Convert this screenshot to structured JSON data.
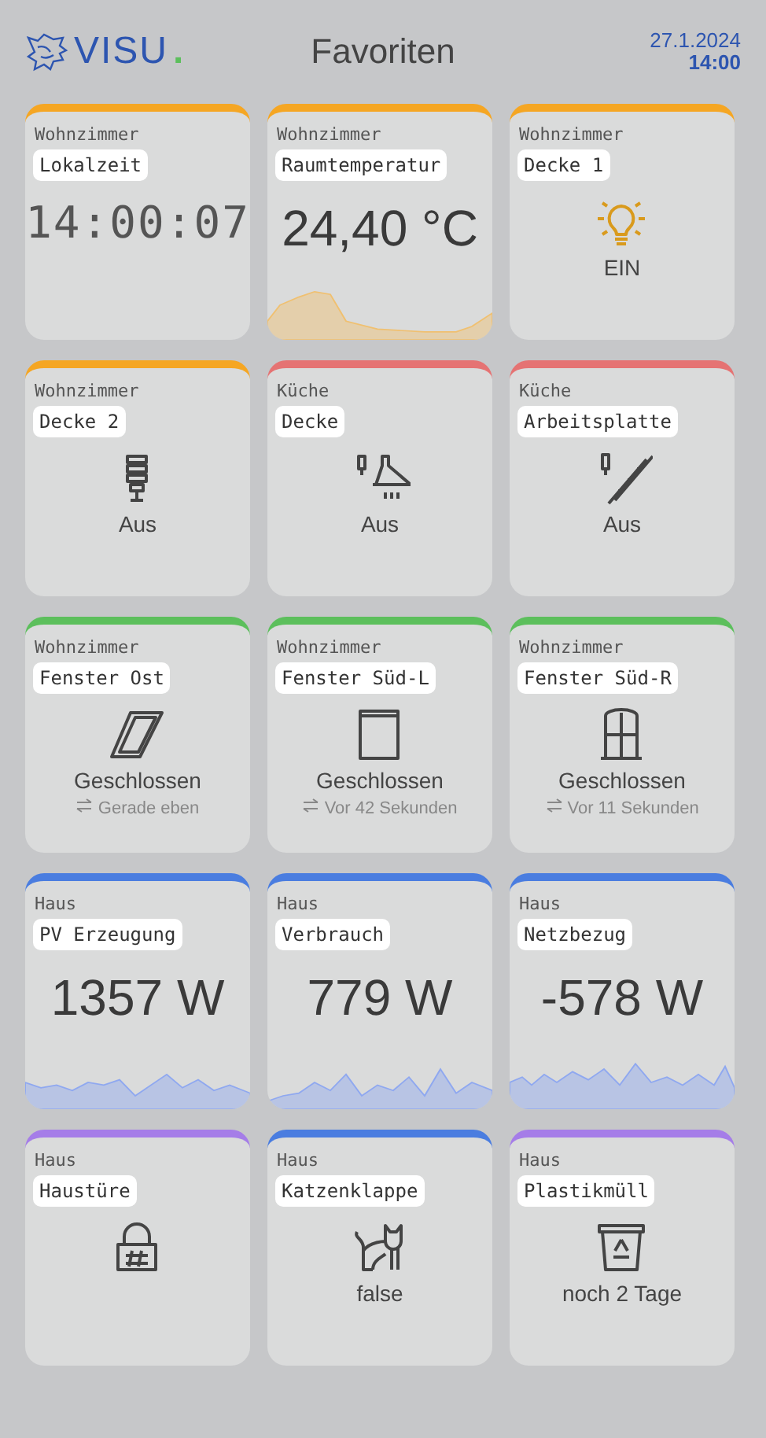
{
  "header": {
    "logo_text": "VISU",
    "logo_dot": ".",
    "title": "Favoriten",
    "date": "27.1.2024",
    "time": "14:00"
  },
  "tiles": [
    {
      "kind": "clock",
      "room": "Wohnzimmer",
      "name": "Lokalzeit",
      "color": "#f5a623",
      "value": "14:00:07"
    },
    {
      "kind": "value",
      "room": "Wohnzimmer",
      "name": "Raumtemperatur",
      "color": "#f5a623",
      "value": "24,40 °C"
    },
    {
      "kind": "status",
      "room": "Wohnzimmer",
      "name": "Decke 1",
      "color": "#f5a623",
      "on": true,
      "state": "EIN"
    },
    {
      "kind": "status",
      "room": "Wohnzimmer",
      "name": "Decke 2",
      "color": "#f5a623",
      "on": false,
      "state": "Aus"
    },
    {
      "kind": "status",
      "room": "Küche",
      "name": "Decke",
      "color": "#e57373",
      "on": false,
      "state": "Aus"
    },
    {
      "kind": "status",
      "room": "Küche",
      "name": "Arbeitsplatte",
      "color": "#e57373",
      "on": false,
      "state": "Aus"
    },
    {
      "kind": "status",
      "room": "Wohnzimmer",
      "name": "Fenster Ost",
      "color": "#5cbf5c",
      "state": "Geschlossen",
      "changed": "Gerade eben"
    },
    {
      "kind": "status",
      "room": "Wohnzimmer",
      "name": "Fenster Süd-L",
      "color": "#5cbf5c",
      "state": "Geschlossen",
      "changed": "Vor 42 Sekunden"
    },
    {
      "kind": "status",
      "room": "Wohnzimmer",
      "name": "Fenster Süd-R",
      "color": "#5cbf5c",
      "state": "Geschlossen",
      "changed": "Vor 11 Sekunden"
    },
    {
      "kind": "value",
      "room": "Haus",
      "name": "PV Erzeugung",
      "color": "#4a7de0",
      "value": "1357 W"
    },
    {
      "kind": "value",
      "room": "Haus",
      "name": "Verbrauch",
      "color": "#4a7de0",
      "value": "779 W"
    },
    {
      "kind": "value",
      "room": "Haus",
      "name": "Netzbezug",
      "color": "#4a7de0",
      "value": "-578 W"
    },
    {
      "kind": "status",
      "room": "Haus",
      "name": "Haustüre",
      "color": "#a57de8"
    },
    {
      "kind": "status",
      "room": "Haus",
      "name": "Katzenklappe",
      "color": "#4a7de0",
      "state": "false"
    },
    {
      "kind": "status",
      "room": "Haus",
      "name": "Plastikmüll",
      "color": "#a57de8",
      "state": "noch 2 Tage"
    }
  ]
}
